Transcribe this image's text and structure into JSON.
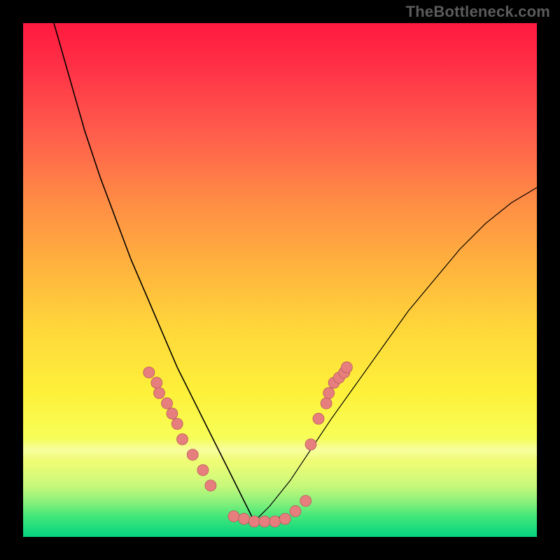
{
  "watermark": "TheBottleneck.com",
  "colors": {
    "page_bg": "#000000",
    "watermark": "#5b5b5b",
    "curve": "#000000",
    "dot_fill": "#e77e7e",
    "dot_stroke": "#b85c5c"
  },
  "chart_data": {
    "type": "line",
    "title": "",
    "xlabel": "",
    "ylabel": "",
    "xlim": [
      0,
      100
    ],
    "ylim": [
      0,
      100
    ],
    "grid": false,
    "legend": false,
    "series": [
      {
        "name": "left-curve",
        "x": [
          6,
          8,
          10,
          12,
          15,
          18,
          21,
          24,
          27,
          30,
          33,
          36,
          39,
          42,
          45
        ],
        "y": [
          100,
          93,
          86,
          79,
          70,
          62,
          54,
          47,
          40,
          33,
          27,
          21,
          15,
          9,
          3
        ]
      },
      {
        "name": "right-curve",
        "x": [
          45,
          48,
          52,
          56,
          60,
          65,
          70,
          75,
          80,
          85,
          90,
          95,
          100
        ],
        "y": [
          3,
          6,
          11,
          17,
          23,
          30,
          37,
          44,
          50,
          56,
          61,
          65,
          68
        ]
      },
      {
        "name": "valley-floor",
        "x": [
          41,
          43,
          45,
          47,
          49,
          51
        ],
        "y": [
          4,
          3,
          2.5,
          2.5,
          3,
          4
        ]
      }
    ],
    "markers": [
      {
        "name": "left-dots",
        "x": [
          24.5,
          26,
          26.5,
          28,
          29,
          30,
          31,
          33,
          35,
          36.5
        ],
        "y": [
          32,
          30,
          28,
          26,
          24,
          22,
          19,
          16,
          13,
          10
        ]
      },
      {
        "name": "valley-dots",
        "x": [
          41,
          43,
          45,
          47,
          49,
          51,
          53,
          55
        ],
        "y": [
          4,
          3.5,
          3,
          3,
          3,
          3.5,
          5,
          7
        ]
      },
      {
        "name": "right-dots",
        "x": [
          56,
          57.5,
          59,
          59.5,
          60.5,
          61.5,
          62.5,
          63
        ],
        "y": [
          18,
          23,
          26,
          28,
          30,
          31,
          32,
          33
        ]
      }
    ],
    "background_gradient": {
      "orientation": "vertical",
      "stops": [
        {
          "pos": 0.0,
          "color": "#ff1a3f"
        },
        {
          "pos": 0.22,
          "color": "#ff5f4c"
        },
        {
          "pos": 0.48,
          "color": "#ffb53d"
        },
        {
          "pos": 0.72,
          "color": "#fdf13a"
        },
        {
          "pos": 0.86,
          "color": "#ecfc76"
        },
        {
          "pos": 1.0,
          "color": "#05d37f"
        }
      ]
    }
  }
}
